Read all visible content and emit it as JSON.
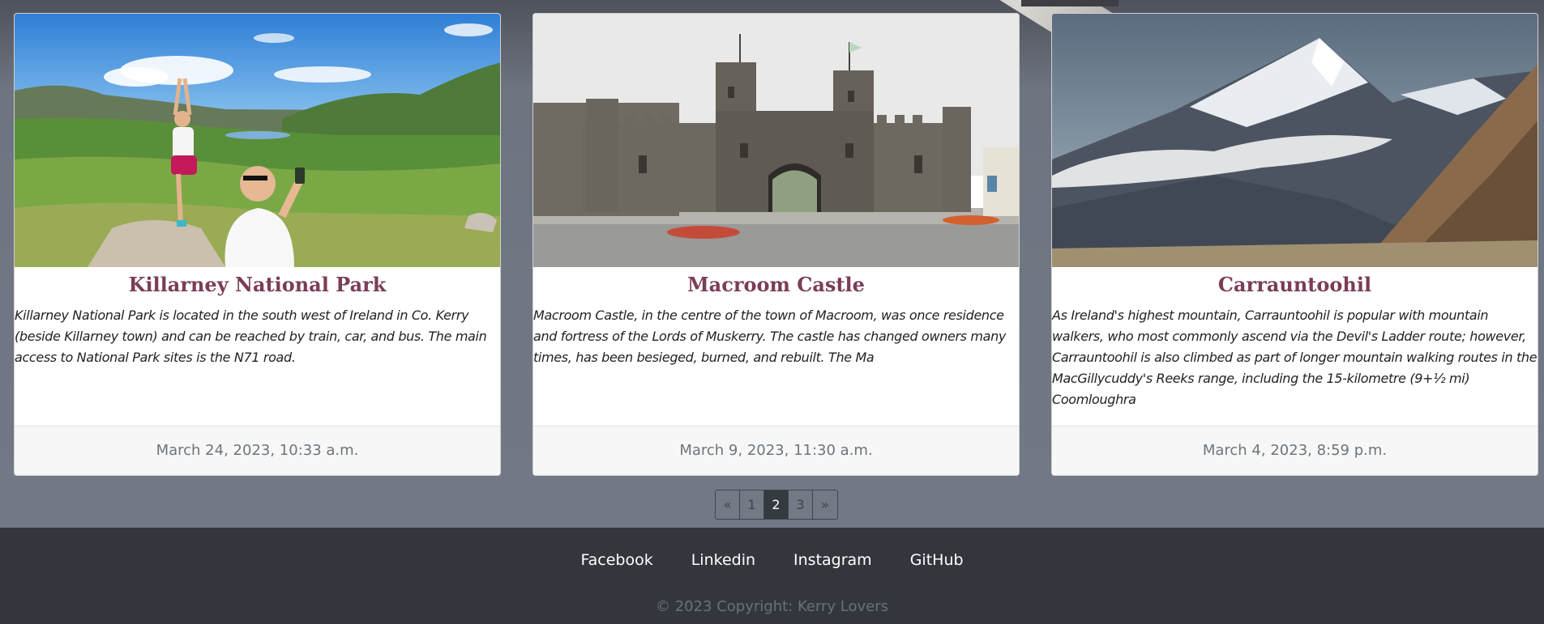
{
  "cards": [
    {
      "title": "Killarney National Park",
      "text": "Killarney National Park is located in the south west of Ireland in Co. Kerry (beside Killarney town) and can be reached by train, car, and bus. The main access to National Park sites is the N71 road.",
      "date": "March 24, 2023, 10:33 a.m."
    },
    {
      "title": "Macroom Castle",
      "text": "Macroom Castle, in the centre of the town of Macroom, was once residence and fortress of the Lords of Muskerry. The castle has changed owners many times, has been besieged, burned, and rebuilt. The Ma",
      "date": "March 9, 2023, 11:30 a.m."
    },
    {
      "title": "Carrauntoohil",
      "text": "As Ireland's highest mountain, Carrauntoohil is popular with mountain walkers, who most commonly ascend via the Devil's Ladder route; however, Carrauntoohil is also climbed as part of longer mountain walking routes in the MacGillycuddy's Reeks range, including the 15-kilometre (9+½ mi) Coomloughra",
      "date": "March 4, 2023, 8:59 p.m."
    }
  ],
  "pagination": {
    "prev": "«",
    "pages": [
      "1",
      "2",
      "3"
    ],
    "active": "2",
    "next": "»"
  },
  "footer": {
    "links": [
      "Facebook",
      "Linkedin",
      "Instagram",
      "GitHub"
    ],
    "copyright": "© 2023 Copyright: Kerry Lovers"
  }
}
